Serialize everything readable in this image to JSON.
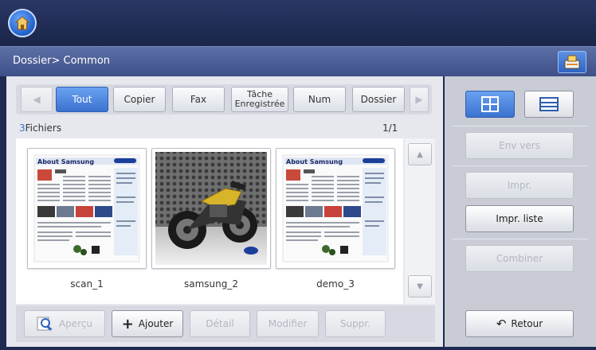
{
  "breadcrumb": "Dossier> Common",
  "tabs": [
    {
      "label": "Tout"
    },
    {
      "label": "Copier"
    },
    {
      "label": "Fax"
    },
    {
      "label_line1": "Tâche",
      "label_line2": "Enregistrée"
    },
    {
      "label": "Num"
    },
    {
      "label": "Dossier"
    }
  ],
  "files": {
    "count": "3",
    "label": "Fichiers",
    "page": "1/1",
    "items": [
      {
        "name": "scan_1",
        "doc_title": "About Samsung"
      },
      {
        "name": "samsung_2"
      },
      {
        "name": "demo_3",
        "doc_title": "About Samsung"
      }
    ]
  },
  "actions": {
    "preview": "Aperçu",
    "add": "Ajouter",
    "detail": "Détail",
    "modify": "Modifier",
    "delete": "Suppr."
  },
  "side": {
    "send": "Env vers",
    "print": "Impr.",
    "print_list": "Impr. liste",
    "combine": "Combiner",
    "back": "Retour"
  },
  "colors": {
    "header": "#1e2a52",
    "path_bar": "#4a5c93",
    "accent": "#3a72d0",
    "panel": "#e6e8ee",
    "sidebar": "#c9ccd5"
  },
  "icons": [
    "home-icon",
    "job-status-icon",
    "arrow-left-icon",
    "arrow-right-icon",
    "grid-view-icon",
    "list-view-icon",
    "scroll-up-icon",
    "scroll-down-icon",
    "magnifier-icon",
    "plus-icon",
    "undo-icon"
  ]
}
